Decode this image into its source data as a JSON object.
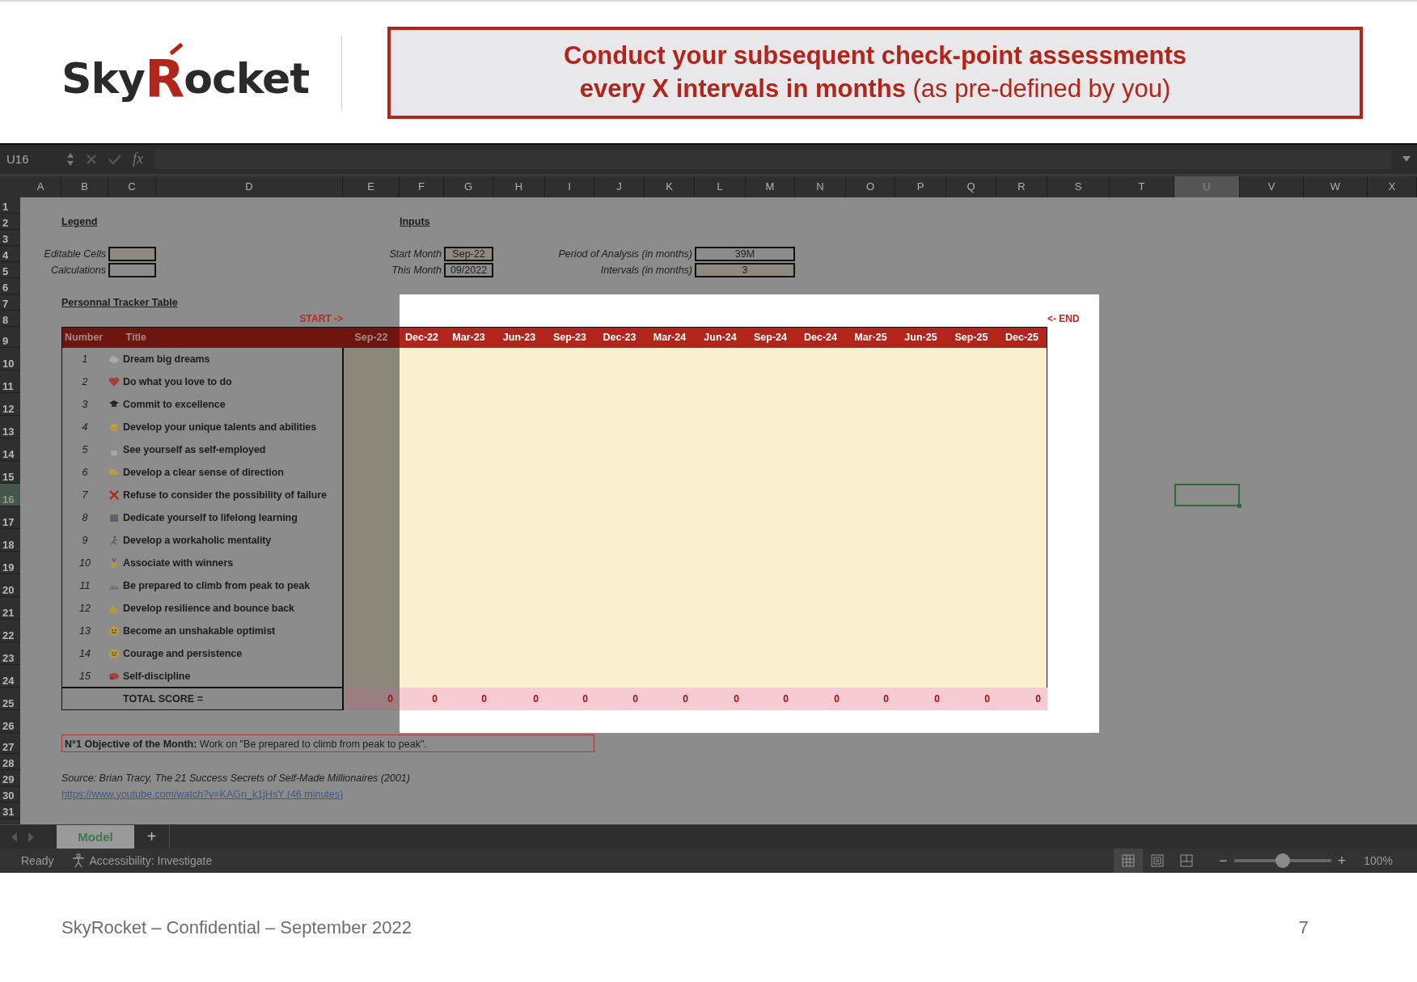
{
  "slide": {
    "logo": [
      "Sky",
      "R",
      "ocket"
    ],
    "banner": [
      "**Conduct your subsequent check-point assessments**",
      "**every X intervals in months** (as pre-defined by you)"
    ]
  },
  "formula_bar": {
    "name_box": "U16",
    "function_label": "fx"
  },
  "columns": [
    {
      "label": "A",
      "selected": false
    },
    {
      "label": "B",
      "selected": false
    },
    {
      "label": "C",
      "selected": false
    },
    {
      "label": "D",
      "selected": false
    },
    {
      "label": "E",
      "selected": false
    },
    {
      "label": "F",
      "selected": false
    },
    {
      "label": "G",
      "selected": false
    },
    {
      "label": "H",
      "selected": false
    },
    {
      "label": "I",
      "selected": false
    },
    {
      "label": "J",
      "selected": false
    },
    {
      "label": "K",
      "selected": false
    },
    {
      "label": "L",
      "selected": false
    },
    {
      "label": "M",
      "selected": false
    },
    {
      "label": "N",
      "selected": false
    },
    {
      "label": "O",
      "selected": false
    },
    {
      "label": "P",
      "selected": false
    },
    {
      "label": "Q",
      "selected": false
    },
    {
      "label": "R",
      "selected": false
    },
    {
      "label": "S",
      "selected": false
    },
    {
      "label": "T",
      "selected": false
    },
    {
      "label": "U",
      "selected": true
    },
    {
      "label": "V",
      "selected": false
    },
    {
      "label": "W",
      "selected": false
    },
    {
      "label": "X",
      "selected": false
    }
  ],
  "rows": [
    {
      "label": "1",
      "selected": false
    },
    {
      "label": "2",
      "selected": false
    },
    {
      "label": "3",
      "selected": false
    },
    {
      "label": "4",
      "selected": false
    },
    {
      "label": "5",
      "selected": false
    },
    {
      "label": "6",
      "selected": false
    },
    {
      "label": "7",
      "selected": false
    },
    {
      "label": "8",
      "selected": false
    },
    {
      "label": "9",
      "selected": false
    },
    {
      "label": "10",
      "selected": false
    },
    {
      "label": "11",
      "selected": false
    },
    {
      "label": "12",
      "selected": false
    },
    {
      "label": "13",
      "selected": false
    },
    {
      "label": "14",
      "selected": false
    },
    {
      "label": "15",
      "selected": false
    },
    {
      "label": "16",
      "selected": true
    },
    {
      "label": "17",
      "selected": false
    },
    {
      "label": "18",
      "selected": false
    },
    {
      "label": "19",
      "selected": false
    },
    {
      "label": "20",
      "selected": false
    },
    {
      "label": "21",
      "selected": false
    },
    {
      "label": "22",
      "selected": false
    },
    {
      "label": "23",
      "selected": false
    },
    {
      "label": "24",
      "selected": false
    },
    {
      "label": "25",
      "selected": false
    },
    {
      "label": "26",
      "selected": false
    },
    {
      "label": "27",
      "selected": false
    },
    {
      "label": "28",
      "selected": false
    },
    {
      "label": "29",
      "selected": false
    },
    {
      "label": "30",
      "selected": false
    },
    {
      "label": "31",
      "selected": false
    }
  ],
  "legend": {
    "title": "Legend",
    "items": [
      {
        "label": "Editable Cells",
        "kind": "editable"
      },
      {
        "label": "Calculations",
        "kind": "calculation"
      }
    ]
  },
  "inputs": {
    "title": "Inputs",
    "fields": [
      {
        "label": "Start Month",
        "value": "Sep-22",
        "kind": "editable"
      },
      {
        "label": "This Month",
        "value": "09/2022",
        "kind": "calculation"
      },
      {
        "label": "Period of Analysis (in months)",
        "value": "39M",
        "kind": "calculation"
      },
      {
        "label": "Intervals (in months)",
        "value": "3",
        "kind": "editable"
      }
    ]
  },
  "tracker": {
    "title": "Personnal Tracker Table",
    "start_marker": "START ->",
    "end_marker": "<- END",
    "number_header": "Number",
    "title_header": "Title",
    "months": [
      {
        "label": "Sep-22",
        "highlighted": false
      },
      {
        "label": "Dec-22",
        "highlighted": true
      },
      {
        "label": "Mar-23",
        "highlighted": true
      },
      {
        "label": "Jun-23",
        "highlighted": true
      },
      {
        "label": "Sep-23",
        "highlighted": true
      },
      {
        "label": "Dec-23",
        "highlighted": true
      },
      {
        "label": "Mar-24",
        "highlighted": true
      },
      {
        "label": "Jun-24",
        "highlighted": true
      },
      {
        "label": "Sep-24",
        "highlighted": true
      },
      {
        "label": "Dec-24",
        "highlighted": true
      },
      {
        "label": "Mar-25",
        "highlighted": true
      },
      {
        "label": "Jun-25",
        "highlighted": true
      },
      {
        "label": "Sep-25",
        "highlighted": true
      },
      {
        "label": "Dec-25",
        "highlighted": true
      }
    ],
    "items": [
      {
        "number": "1",
        "title": "Dream big dreams"
      },
      {
        "number": "2",
        "title": "Do what you love to do"
      },
      {
        "number": "3",
        "title": "Commit to excellence"
      },
      {
        "number": "4",
        "title": "Develop your unique talents and abilities"
      },
      {
        "number": "5",
        "title": "See yourself as self-employed"
      },
      {
        "number": "6",
        "title": "Develop a clear sense of direction"
      },
      {
        "number": "7",
        "title": "Refuse to consider the possibility of failure"
      },
      {
        "number": "8",
        "title": "Dedicate yourself to lifelong learning"
      },
      {
        "number": "9",
        "title": "Develop a workaholic mentality"
      },
      {
        "number": "10",
        "title": "Associate with winners"
      },
      {
        "number": "11",
        "title": "Be prepared to climb from peak to peak"
      },
      {
        "number": "12",
        "title": "Develop resilience and bounce back"
      },
      {
        "number": "13",
        "title": "Become an unshakable optimist"
      },
      {
        "number": "14",
        "title": "Courage and persistence"
      },
      {
        "number": "15",
        "title": "Self-discipline"
      }
    ],
    "total_label": "TOTAL SCORE =",
    "totals": [
      "0",
      "0",
      "0",
      "0",
      "0",
      "0",
      "0",
      "0",
      "0",
      "0",
      "0",
      "0",
      "0",
      "0"
    ]
  },
  "objective": "**N°1 Objective of the Month:** Work on \"Be prepared to climb from peak to peak\".",
  "source": "Source: Brian Tracy, The 21 Success Secrets of Self-Made Millionaires (2001)",
  "link": "https://www.youtube.com/watch?v=KAGn_k1jHsY (46 minutes)",
  "sheet_tabs": [
    {
      "label": "Model",
      "selected": true
    }
  ],
  "add_sheet": "+",
  "status_bar": {
    "status": "Ready",
    "accessibility": "Accessibility: Investigate",
    "views": [
      {
        "kind": "normal",
        "selected": true
      },
      {
        "kind": "page_layout",
        "selected": false
      },
      {
        "kind": "page_break",
        "selected": false
      }
    ],
    "zoom_out": "−",
    "zoom_in": "+",
    "zoom": {
      "level": 0.5
    },
    "zoom_label": "100%"
  },
  "footer": {
    "text": "SkyRocket – Confidential – September 2022",
    "page_number": "7"
  }
}
